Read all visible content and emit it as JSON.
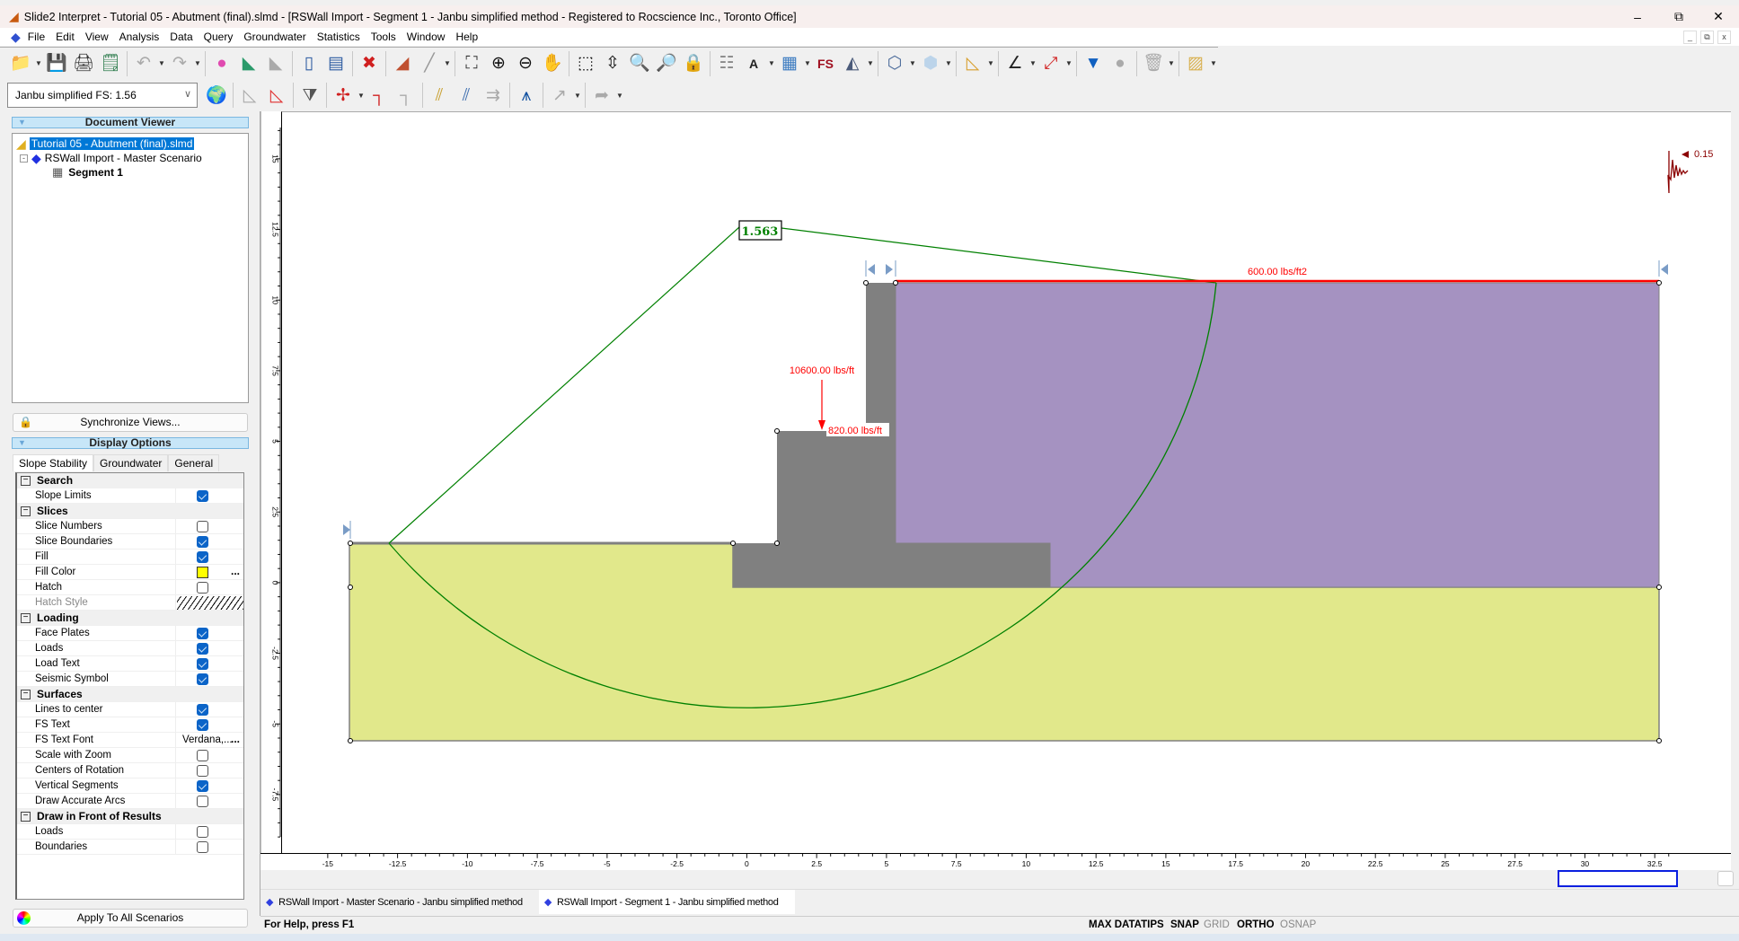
{
  "window": {
    "title": "Slide2 Interpret - Tutorial 05 - Abutment (final).slmd - [RSWall Import - Segment 1 - Janbu simplified method - Registered to Rocscience Inc., Toronto Office]",
    "minimize": "–",
    "restore": "⧉",
    "close": "✕"
  },
  "menu": [
    "File",
    "Edit",
    "View",
    "Analysis",
    "Data",
    "Query",
    "Groundwater",
    "Statistics",
    "Tools",
    "Window",
    "Help"
  ],
  "mdi_controls": [
    "_",
    "⧉",
    "x"
  ],
  "toolbar1": [
    {
      "icon": "open-folder-icon",
      "glyph": "📁",
      "color": "#e0a030",
      "dd": true
    },
    {
      "icon": "save-icon",
      "glyph": "💾",
      "color": "#1e3f7a"
    },
    {
      "icon": "print-icon",
      "glyph": "🖨",
      "color": "#333"
    },
    {
      "icon": "print-preview-icon",
      "glyph": "🗒",
      "color": "#2a7a4a",
      "sep": true
    },
    {
      "icon": "undo-icon",
      "glyph": "↶",
      "color": "#aaa",
      "dd": true
    },
    {
      "icon": "redo-icon",
      "glyph": "↷",
      "color": "#aaa",
      "dd": true,
      "sep": true
    },
    {
      "icon": "color-wheel-icon",
      "glyph": "●",
      "color": "#e04ab0"
    },
    {
      "icon": "legend-icon",
      "glyph": "◣",
      "color": "#2a9a6a"
    },
    {
      "icon": "contours-icon",
      "glyph": "◣",
      "color": "#aaa",
      "sep": true
    },
    {
      "icon": "split-vertical-icon",
      "glyph": "▯",
      "color": "#2b5aa0"
    },
    {
      "icon": "split-horizontal-icon",
      "glyph": "▤",
      "color": "#2b5aa0",
      "sep": true
    },
    {
      "icon": "close-view-icon",
      "glyph": "✖",
      "color": "#d02020",
      "sep": true
    },
    {
      "icon": "slope-profile-icon",
      "glyph": "◢",
      "color": "#c05030"
    },
    {
      "icon": "query-line-icon",
      "glyph": "╱",
      "color": "#999",
      "dd": true,
      "sep": true
    },
    {
      "icon": "zoom-extents-icon",
      "glyph": "⛶",
      "color": "#333"
    },
    {
      "icon": "zoom-in-icon",
      "glyph": "⊕",
      "color": "#111"
    },
    {
      "icon": "zoom-out-icon",
      "glyph": "⊖",
      "color": "#111"
    },
    {
      "icon": "pan-icon",
      "glyph": "✋",
      "color": "#c89a50",
      "sep": true
    },
    {
      "icon": "zoom-window-icon",
      "glyph": "⬚",
      "color": "#111"
    },
    {
      "icon": "zoom-scroll-icon",
      "glyph": "⇳",
      "color": "#111"
    },
    {
      "icon": "zoom-magnify-icon",
      "glyph": "🔍",
      "color": "#d0a020"
    },
    {
      "icon": "zoom-previous-icon",
      "glyph": "🔎",
      "color": "#d0a020"
    },
    {
      "icon": "zoom-lock-icon",
      "glyph": "🔒",
      "color": "#a07020",
      "sep": true
    },
    {
      "icon": "text-box-icon",
      "glyph": "☷",
      "color": "#888"
    },
    {
      "icon": "annotation-text-icon",
      "glyph": "A",
      "color": "#222",
      "dd": true
    },
    {
      "icon": "table-icon",
      "glyph": "▦",
      "color": "#3a7ac0",
      "dd": true
    },
    {
      "icon": "fs-label-icon",
      "glyph": "FS",
      "color": "#a01020"
    },
    {
      "icon": "image-icon",
      "glyph": "◭",
      "color": "#4a5a7a",
      "dd": true,
      "sep": true
    },
    {
      "icon": "polygon-icon",
      "glyph": "⬡",
      "color": "#4a6a9a",
      "dd": true
    },
    {
      "icon": "hexagon-icon",
      "glyph": "⬢",
      "color": "#bcd4ea",
      "dd": true,
      "sep": true
    },
    {
      "icon": "triangle-ruler-icon",
      "glyph": "◺",
      "color": "#d8a030",
      "dd": true,
      "sep": true
    },
    {
      "icon": "angle-icon",
      "glyph": "∠",
      "color": "#222",
      "dd": true
    },
    {
      "icon": "dimension-icon",
      "glyph": "⤢",
      "color": "#d02020",
      "dd": true,
      "sep": true
    },
    {
      "icon": "water-table-icon",
      "glyph": "▼",
      "color": "#1060c0"
    },
    {
      "icon": "sphere-icon",
      "glyph": "●",
      "color": "#aaa",
      "sep": true
    },
    {
      "icon": "delete-icon",
      "glyph": "🗑",
      "color": "#aaa",
      "dd": true,
      "sep": true
    },
    {
      "icon": "materials-icon",
      "glyph": "▨",
      "color": "#d8b050",
      "dd": true
    }
  ],
  "toolbar2": {
    "method_select": "Janbu simplified FS:  1.56",
    "items": [
      {
        "icon": "globe-icon",
        "glyph": "🌍",
        "color": "#2a7a2a",
        "sep": true
      },
      {
        "icon": "slip-surface-icon",
        "glyph": "◺",
        "color": "#aaa"
      },
      {
        "icon": "all-surfaces-icon",
        "glyph": "◺",
        "color": "#e03030",
        "sep": true
      },
      {
        "icon": "filter-icon",
        "glyph": "⧩",
        "color": "#555",
        "sep": true
      },
      {
        "icon": "add-query-icon",
        "glyph": "✢",
        "color": "#d02020",
        "dd": true
      },
      {
        "icon": "query-icon",
        "glyph": "┐",
        "color": "#d02020"
      },
      {
        "icon": "delete-query-icon",
        "glyph": "┐",
        "color": "#aaa",
        "sep": true
      },
      {
        "icon": "slice-data-icon",
        "glyph": "⫽",
        "color": "#c8a030"
      },
      {
        "icon": "slices-icon",
        "glyph": "⫽",
        "color": "#4070b0"
      },
      {
        "icon": "forces-icon",
        "glyph": "⇉",
        "color": "#aaa",
        "sep": true
      },
      {
        "icon": "graph-icon",
        "glyph": "⩚",
        "color": "#1050a0",
        "sep": true
      },
      {
        "icon": "probe-icon",
        "glyph": "↗",
        "color": "#aaa",
        "dd": true,
        "sep": true
      },
      {
        "icon": "view-icon",
        "glyph": "➦",
        "color": "#aaa",
        "dd": true
      }
    ]
  },
  "document_viewer": {
    "title": "Document Viewer",
    "file": "Tutorial 05 - Abutment (final).slmd",
    "scenario": "RSWall Import - Master Scenario",
    "segment": "Segment 1"
  },
  "sync_button": "Synchronize Views...",
  "display_options": {
    "title": "Display Options",
    "tabs": [
      "Slope Stability",
      "Groundwater",
      "General"
    ],
    "rows": [
      {
        "group": "Search"
      },
      {
        "label": "Slope Limits",
        "checked": true
      },
      {
        "group": "Slices"
      },
      {
        "label": "Slice Numbers",
        "checked": false
      },
      {
        "label": "Slice Boundaries",
        "checked": true
      },
      {
        "label": "Fill",
        "checked": true
      },
      {
        "label": "Fill Color",
        "color": "#ffff00",
        "more": "..."
      },
      {
        "label": "Hatch",
        "checked": false
      },
      {
        "label": "Hatch Style",
        "hatch": true,
        "disabled": true
      },
      {
        "group": "Loading"
      },
      {
        "label": "Face Plates",
        "checked": true
      },
      {
        "label": "Loads",
        "checked": true
      },
      {
        "label": "Load Text",
        "checked": true
      },
      {
        "label": "Seismic Symbol",
        "checked": true
      },
      {
        "group": "Surfaces"
      },
      {
        "label": "Lines to center",
        "checked": true
      },
      {
        "label": "FS Text",
        "checked": true
      },
      {
        "label": "FS Text Font",
        "text": "Verdana,...",
        "more": "..."
      },
      {
        "label": "Scale with Zoom",
        "checked": false
      },
      {
        "label": "Centers of Rotation",
        "checked": false
      },
      {
        "label": "Vertical Segments",
        "checked": true
      },
      {
        "label": "Draw Accurate Arcs",
        "checked": false
      },
      {
        "group": "Draw in Front of Results"
      },
      {
        "label": "Loads",
        "checked": false
      },
      {
        "label": "Boundaries",
        "checked": false
      }
    ]
  },
  "apply_button": "Apply To All Scenarios",
  "model": {
    "fs_label": "1.563",
    "distributed_load": "600.00 lbs/ft2",
    "point_load": "10600.00 lbs/ft",
    "line_load": "820.00 lbs/ft",
    "seismic": "0.15",
    "colors": {
      "lower_soil": "#e1e88b",
      "backfill": "#a592c1",
      "wall": "#808080",
      "slip_surface": "#008000",
      "load": "#ff0000"
    },
    "x_ticks": [
      "-15",
      "-12.5",
      "-10",
      "-7.5",
      "-5",
      "-2.5",
      "0",
      "2.5",
      "5",
      "7.5",
      "10",
      "12.5",
      "15",
      "17.5",
      "20",
      "22.5",
      "25",
      "27.5",
      "30",
      "32.5"
    ],
    "y_ticks": [
      "-7.5",
      "-5",
      "-2.5",
      "0",
      "2.5",
      "5",
      "7.5",
      "10",
      "12.5",
      "15"
    ]
  },
  "doc_tabs": [
    "RSWall Import - Master Scenario - Janbu simplified method",
    "RSWall Import - Segment 1 - Janbu simplified method"
  ],
  "status": {
    "help": "For Help, press F1",
    "indicators": [
      {
        "label": "MAX DATATIPS",
        "active": true
      },
      {
        "label": "SNAP",
        "active": true
      },
      {
        "label": "GRID",
        "active": false
      },
      {
        "label": "ORTHO",
        "active": true
      },
      {
        "label": "OSNAP",
        "active": false
      }
    ]
  }
}
